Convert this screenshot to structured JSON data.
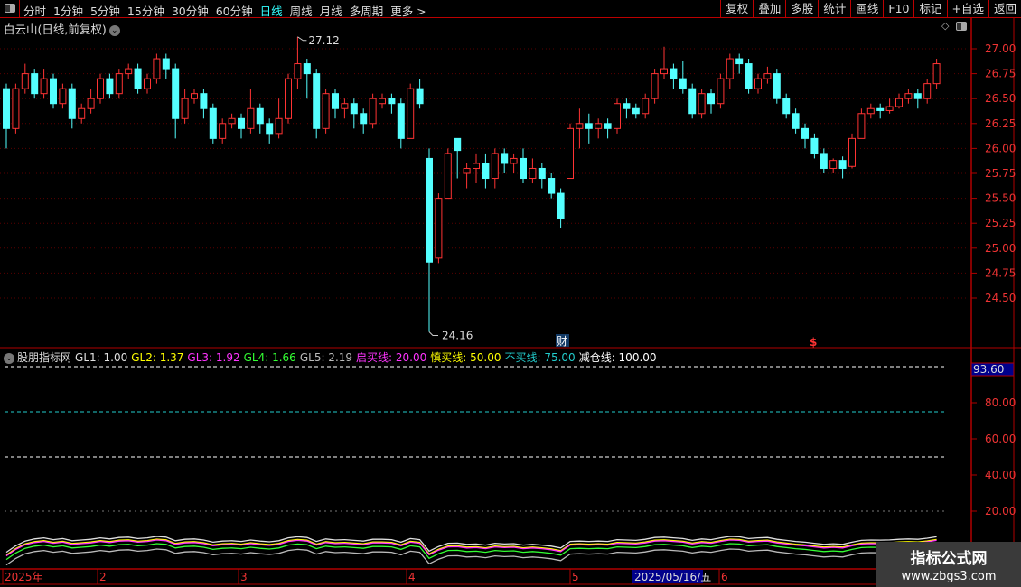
{
  "toolbar": {
    "periods": [
      "分时",
      "1分钟",
      "5分钟",
      "15分钟",
      "30分钟",
      "60分钟",
      "日线",
      "周线",
      "月线",
      "多周期",
      "更多 >"
    ],
    "active": "日线",
    "buttons": [
      "复权",
      "叠加",
      "多股",
      "统计",
      "画线",
      "F10",
      "标记",
      "+自选",
      "返回"
    ]
  },
  "title": "白云山(日线,前复权)",
  "price_axis": [
    "27.00",
    "26.75",
    "26.50",
    "26.25",
    "26.00",
    "25.75",
    "25.50",
    "25.25",
    "25.00",
    "24.75",
    "24.50"
  ],
  "high_label": "27.12",
  "low_label": "24.16",
  "marker_cai": "财",
  "marker_s": "$",
  "indicator": {
    "name": "股朋指标网",
    "items": [
      {
        "label": "GL1: 1.00",
        "color": "#e0e0e0"
      },
      {
        "label": "GL2: 1.37",
        "color": "#ffff00"
      },
      {
        "label": "GL3: 1.92",
        "color": "#ff33ff"
      },
      {
        "label": "GL4: 1.66",
        "color": "#33ff33"
      },
      {
        "label": "GL5: 2.19",
        "color": "#bbbbbb"
      },
      {
        "label": "启买线: 20.00",
        "color": "#ff33ff"
      },
      {
        "label": "慎买线: 50.00",
        "color": "#ffff00"
      },
      {
        "label": "不买线: 75.00",
        "color": "#22cccc"
      },
      {
        "label": "减仓线: 100.00",
        "color": "#ffffff"
      }
    ],
    "axis": [
      "80.00",
      "60.00",
      "40.00",
      "20.00"
    ],
    "current": "93.60",
    "levels": [
      100,
      75,
      50,
      20
    ]
  },
  "date_axis": [
    "2025年",
    "2",
    "3",
    "4",
    "5",
    "2025/05/16/五",
    "6"
  ],
  "watermark": {
    "title": "指标公式网",
    "url": "www.zbgs3.com"
  },
  "colors": {
    "up": "#ff3333",
    "down": "#54ffff",
    "grid": "#b00000"
  },
  "candles": [
    [
      26.6,
      26.65,
      26.0,
      26.2
    ],
    [
      26.2,
      26.65,
      26.15,
      26.6
    ],
    [
      26.6,
      26.85,
      26.55,
      26.75
    ],
    [
      26.75,
      26.8,
      26.5,
      26.55
    ],
    [
      26.55,
      26.8,
      26.5,
      26.7
    ],
    [
      26.7,
      26.75,
      26.4,
      26.45
    ],
    [
      26.45,
      26.65,
      26.4,
      26.6
    ],
    [
      26.6,
      26.65,
      26.2,
      26.3
    ],
    [
      26.3,
      26.45,
      26.25,
      26.4
    ],
    [
      26.4,
      26.6,
      26.35,
      26.5
    ],
    [
      26.5,
      26.75,
      26.45,
      26.7
    ],
    [
      26.7,
      26.75,
      26.5,
      26.55
    ],
    [
      26.55,
      26.8,
      26.5,
      26.75
    ],
    [
      26.75,
      26.85,
      26.7,
      26.8
    ],
    [
      26.8,
      26.85,
      26.55,
      26.6
    ],
    [
      26.6,
      26.75,
      26.55,
      26.7
    ],
    [
      26.7,
      26.95,
      26.65,
      26.9
    ],
    [
      26.9,
      26.95,
      26.7,
      26.8
    ],
    [
      26.8,
      26.85,
      26.1,
      26.3
    ],
    [
      26.3,
      26.6,
      26.25,
      26.5
    ],
    [
      26.5,
      26.6,
      26.45,
      26.55
    ],
    [
      26.55,
      26.6,
      26.3,
      26.4
    ],
    [
      26.4,
      26.45,
      26.05,
      26.1
    ],
    [
      26.1,
      26.3,
      26.05,
      26.25
    ],
    [
      26.25,
      26.35,
      26.2,
      26.3
    ],
    [
      26.3,
      26.35,
      26.1,
      26.2
    ],
    [
      26.2,
      26.6,
      26.15,
      26.4
    ],
    [
      26.4,
      26.45,
      26.15,
      26.25
    ],
    [
      26.25,
      26.3,
      26.05,
      26.15
    ],
    [
      26.15,
      26.5,
      26.1,
      26.3
    ],
    [
      26.3,
      26.75,
      26.25,
      26.7
    ],
    [
      26.7,
      27.12,
      26.6,
      26.85
    ],
    [
      26.85,
      26.9,
      26.5,
      26.75
    ],
    [
      26.75,
      26.8,
      26.1,
      26.2
    ],
    [
      26.2,
      26.6,
      26.15,
      26.55
    ],
    [
      26.55,
      26.6,
      26.3,
      26.4
    ],
    [
      26.4,
      26.5,
      26.3,
      26.45
    ],
    [
      26.45,
      26.5,
      26.2,
      26.35
    ],
    [
      26.35,
      26.4,
      26.15,
      26.25
    ],
    [
      26.25,
      26.55,
      26.2,
      26.5
    ],
    [
      26.45,
      26.55,
      26.4,
      26.5
    ],
    [
      26.5,
      26.55,
      26.35,
      26.45
    ],
    [
      26.45,
      26.5,
      26.0,
      26.1
    ],
    [
      26.1,
      26.65,
      26.1,
      26.6
    ],
    [
      26.6,
      26.7,
      26.4,
      26.45
    ],
    [
      25.9,
      26.0,
      24.16,
      24.86
    ],
    [
      24.9,
      25.55,
      24.85,
      25.5
    ],
    [
      25.5,
      26.0,
      25.5,
      25.95
    ],
    [
      26.1,
      26.1,
      25.7,
      25.98
    ],
    [
      25.75,
      25.85,
      25.6,
      25.8
    ],
    [
      25.8,
      25.95,
      25.65,
      25.85
    ],
    [
      25.85,
      25.95,
      25.6,
      25.7
    ],
    [
      25.7,
      26.0,
      25.6,
      25.95
    ],
    [
      25.95,
      26.0,
      25.75,
      25.85
    ],
    [
      25.85,
      25.95,
      25.75,
      25.9
    ],
    [
      25.9,
      26.0,
      25.65,
      25.7
    ],
    [
      25.7,
      25.9,
      25.65,
      25.8
    ],
    [
      25.8,
      25.85,
      25.6,
      25.7
    ],
    [
      25.7,
      25.75,
      25.5,
      25.55
    ],
    [
      25.55,
      25.6,
      25.2,
      25.3
    ],
    [
      25.7,
      26.25,
      25.7,
      26.2
    ],
    [
      26.2,
      26.4,
      26.0,
      26.25
    ],
    [
      26.25,
      26.35,
      26.05,
      26.2
    ],
    [
      26.2,
      26.3,
      26.1,
      26.25
    ],
    [
      26.25,
      26.3,
      26.1,
      26.2
    ],
    [
      26.2,
      26.5,
      26.15,
      26.45
    ],
    [
      26.45,
      26.5,
      26.3,
      26.4
    ],
    [
      26.4,
      26.45,
      26.3,
      26.35
    ],
    [
      26.35,
      26.55,
      26.3,
      26.5
    ],
    [
      26.5,
      26.8,
      26.45,
      26.75
    ],
    [
      26.75,
      27.02,
      26.7,
      26.8
    ],
    [
      26.8,
      26.85,
      26.6,
      26.7
    ],
    [
      26.7,
      26.88,
      26.55,
      26.6
    ],
    [
      26.6,
      26.65,
      26.3,
      26.35
    ],
    [
      26.35,
      26.6,
      26.3,
      26.55
    ],
    [
      26.55,
      26.6,
      26.35,
      26.45
    ],
    [
      26.45,
      26.75,
      26.4,
      26.7
    ],
    [
      26.7,
      26.95,
      26.6,
      26.9
    ],
    [
      26.9,
      26.95,
      26.75,
      26.85
    ],
    [
      26.85,
      26.9,
      26.55,
      26.6
    ],
    [
      26.6,
      26.75,
      26.55,
      26.7
    ],
    [
      26.7,
      26.82,
      26.65,
      26.75
    ],
    [
      26.75,
      26.8,
      26.45,
      26.5
    ],
    [
      26.5,
      26.55,
      26.3,
      26.35
    ],
    [
      26.35,
      26.4,
      26.15,
      26.2
    ],
    [
      26.2,
      26.25,
      26.0,
      26.1
    ],
    [
      26.1,
      26.15,
      25.9,
      25.95
    ],
    [
      25.95,
      26.0,
      25.75,
      25.8
    ],
    [
      25.8,
      25.9,
      25.75,
      25.88
    ],
    [
      25.88,
      25.92,
      25.7,
      25.8
    ],
    [
      25.82,
      26.15,
      25.8,
      26.1
    ],
    [
      26.1,
      26.4,
      26.1,
      26.35
    ],
    [
      26.35,
      26.45,
      26.3,
      26.4
    ],
    [
      26.4,
      26.45,
      26.3,
      26.38
    ],
    [
      26.38,
      26.5,
      26.35,
      26.42
    ],
    [
      26.42,
      26.55,
      26.4,
      26.5
    ],
    [
      26.5,
      26.6,
      26.45,
      26.55
    ],
    [
      26.55,
      26.6,
      26.4,
      26.5
    ],
    [
      26.5,
      26.7,
      26.45,
      26.65
    ],
    [
      26.65,
      26.9,
      26.6,
      26.85
    ]
  ]
}
